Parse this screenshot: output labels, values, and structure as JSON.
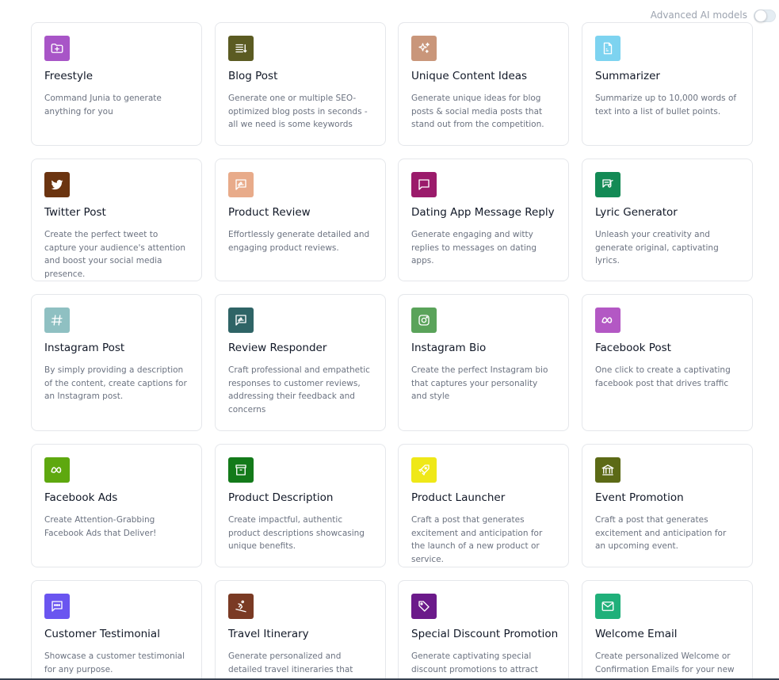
{
  "header": {
    "advanced_label": "Advanced AI models",
    "advanced_enabled": false
  },
  "cards": [
    {
      "title": "Freestyle",
      "desc": "Command Junia to generate anything for you",
      "color": "#a855c7",
      "icon": "folder-plus-icon"
    },
    {
      "title": "Blog Post",
      "desc": "Generate one or multiple SEO-optimized blog posts in seconds - all we need is some keywords",
      "color": "#5b5b22",
      "icon": "list-icon"
    },
    {
      "title": "Unique Content Ideas",
      "desc": "Generate unique ideas for blog posts & social media posts that stand out from the competition.",
      "color": "#c9967a",
      "icon": "sparkles-icon"
    },
    {
      "title": "Summarizer",
      "desc": "Summarize up to 10,000 words of text into a list of bullet points.",
      "color": "#7dd3f0",
      "icon": "document-icon"
    },
    {
      "title": "Twitter Post",
      "desc": "Create the perfect tweet to capture your audience's attention and boost your social media presence.",
      "color": "#6b3410",
      "icon": "twitter-icon"
    },
    {
      "title": "Product Review",
      "desc": "Effortlessly generate detailed and engaging product reviews.",
      "color": "#e8ab8a",
      "icon": "review-icon"
    },
    {
      "title": "Dating App Message Reply",
      "desc": "Generate engaging and witty replies to messages on dating apps.",
      "color": "#9b1b6b",
      "icon": "message-square-icon"
    },
    {
      "title": "Lyric Generator",
      "desc": "Unleash your creativity and generate original, captivating lyrics.",
      "color": "#138a55",
      "icon": "lyrics-icon"
    },
    {
      "title": "Instagram Post",
      "desc": "By simply providing a description of the content, create captions for an Instagram post.",
      "color": "#8fc0c2",
      "icon": "hashtag-icon"
    },
    {
      "title": "Review Responder",
      "desc": "Craft professional and empathetic responses to customer reviews, addressing their feedback and concerns",
      "color": "#2f6466",
      "icon": "review-icon"
    },
    {
      "title": "Instagram Bio",
      "desc": "Create the perfect Instagram bio that captures your personality and style",
      "color": "#5aa35a",
      "icon": "instagram-icon"
    },
    {
      "title": "Facebook Post",
      "desc": "One click to create a captivating facebook post that drives traffic",
      "color": "#b358c4",
      "icon": "meta-icon"
    },
    {
      "title": "Facebook Ads",
      "desc": "Create Attention-Grabbing Facebook Ads that Deliver!",
      "color": "#5ea80f",
      "icon": "meta-icon"
    },
    {
      "title": "Product Description",
      "desc": "Create impactful, authentic product descriptions showcasing unique benefits.",
      "color": "#137a1a",
      "icon": "archive-icon"
    },
    {
      "title": "Product Launcher",
      "desc": "Craft a post that generates excitement and anticipation for the launch of a new product or service.",
      "color": "#efe818",
      "icon": "rocket-icon"
    },
    {
      "title": "Event Promotion",
      "desc": "Craft a post that generates excitement and anticipation for an upcoming event.",
      "color": "#5c6a16",
      "icon": "building-icon"
    },
    {
      "title": "Customer Testimonial",
      "desc": "Showcase a customer testimonial for any purpose.",
      "color": "#6a55f0",
      "icon": "chat-dots-icon"
    },
    {
      "title": "Travel Itinerary",
      "desc": "Generate personalized and detailed travel itineraries that cater to",
      "color": "#7a3a24",
      "icon": "skiing-icon"
    },
    {
      "title": "Special Discount Promotion",
      "desc": "Generate captivating special discount promotions to attract",
      "color": "#6b1a8a",
      "icon": "tag-icon"
    },
    {
      "title": "Welcome Email",
      "desc": "Create personalized Welcome or Confirmation Emails for your new",
      "color": "#20b07a",
      "icon": "mail-icon"
    }
  ]
}
